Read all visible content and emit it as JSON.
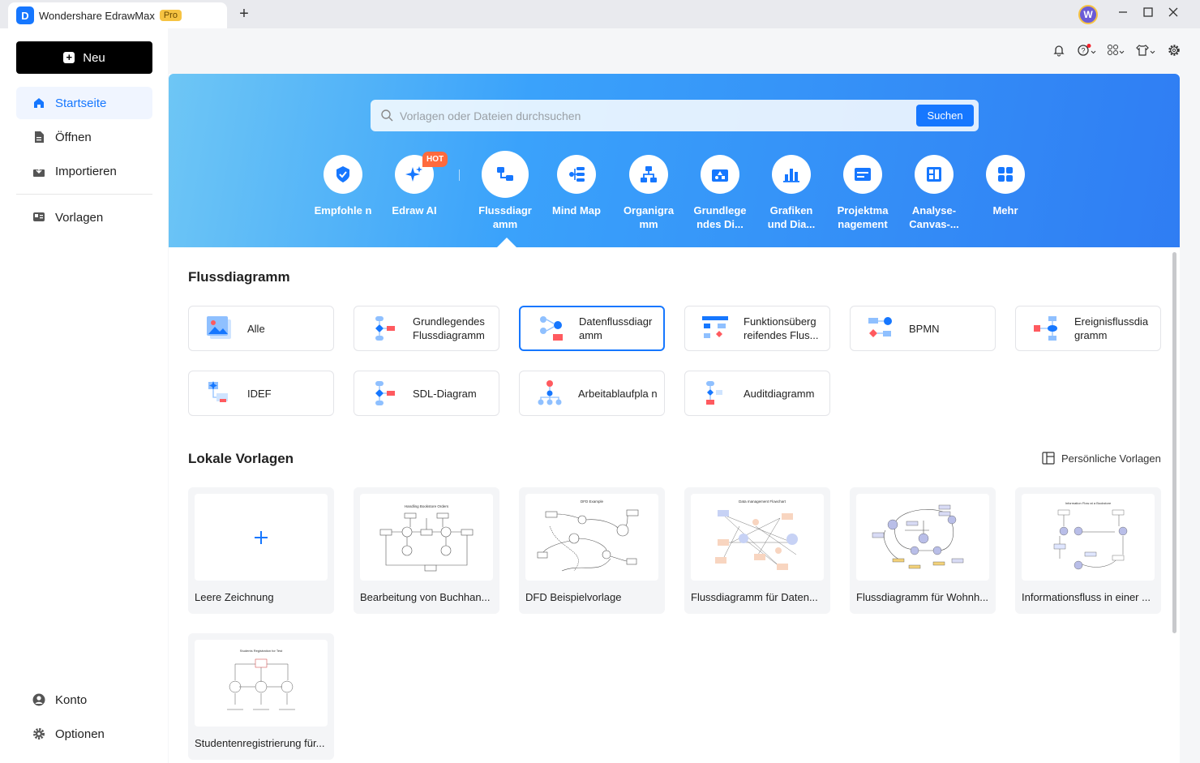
{
  "titlebar": {
    "app_name": "Wondershare EdrawMax",
    "badge": "Pro",
    "new_tab": "+",
    "avatar_letter": "W"
  },
  "sidebar": {
    "new_button": "Neu",
    "items": [
      {
        "label": "Startseite",
        "icon": "home-icon",
        "active": true
      },
      {
        "label": "Öffnen",
        "icon": "file-icon"
      },
      {
        "label": "Importieren",
        "icon": "import-icon"
      },
      {
        "label": "Vorlagen",
        "icon": "templates-icon"
      }
    ],
    "bottom": [
      {
        "label": "Konto",
        "icon": "user-icon"
      },
      {
        "label": "Optionen",
        "icon": "gear-icon"
      }
    ]
  },
  "search": {
    "placeholder": "Vorlagen oder Dateien durchsuchen",
    "button": "Suchen"
  },
  "categories": [
    {
      "label": "Empfohle n",
      "icon": "recommend-icon"
    },
    {
      "label": "Edraw AI",
      "icon": "ai-sparkle-icon",
      "badge": "HOT"
    },
    {
      "label": "Flussdiagr amm",
      "icon": "flowchart-icon",
      "active": true
    },
    {
      "label": "Mind Map",
      "icon": "mindmap-icon"
    },
    {
      "label": "Organigra mm",
      "icon": "orgchart-icon"
    },
    {
      "label": "Grundlege ndes Di...",
      "icon": "basic-diagram-icon"
    },
    {
      "label": "Grafiken und Dia...",
      "icon": "chart-icon"
    },
    {
      "label": "Projektma nagement",
      "icon": "project-icon"
    },
    {
      "label": "Analyse-Canvas-...",
      "icon": "canvas-icon"
    },
    {
      "label": "Mehr",
      "icon": "more-icon"
    }
  ],
  "flow_section": {
    "title": "Flussdiagramm"
  },
  "flow_types": [
    {
      "label": "Alle"
    },
    {
      "label": "Grundlegendes Flussdiagramm"
    },
    {
      "label": "Datenflussdiagr amm",
      "selected": true
    },
    {
      "label": "Funktionsüberg reifendes Flus..."
    },
    {
      "label": "BPMN"
    },
    {
      "label": "Ereignisflussdia gramm"
    },
    {
      "label": "IDEF"
    },
    {
      "label": "SDL-Diagram"
    },
    {
      "label": "Arbeitablaufpla n"
    },
    {
      "label": "Auditdiagramm"
    }
  ],
  "local_section": {
    "title": "Lokale Vorlagen",
    "personal_link": "Persönliche Vorlagen"
  },
  "local_templates": [
    {
      "label": "Leere Zeichnung",
      "thumb_title": ""
    },
    {
      "label": "Bearbeitung von Buchhan...",
      "thumb_title": "Handling Bookstore Orders"
    },
    {
      "label": "DFD Beispielvorlage",
      "thumb_title": "DFD Example"
    },
    {
      "label": "Flussdiagramm für Daten...",
      "thumb_title": "Data management Flowchart"
    },
    {
      "label": "Flussdiagramm für Wohnh...",
      "thumb_title": ""
    },
    {
      "label": "Informationsfluss in einer ...",
      "thumb_title": "Information Flow at a Bookstore"
    },
    {
      "label": "Studentenregistrierung für...",
      "thumb_title": "Students Registration for Test"
    }
  ],
  "colors": {
    "accent": "#1677ff",
    "hero_start": "#6ec6f5",
    "hero_end": "#2f7df3"
  }
}
